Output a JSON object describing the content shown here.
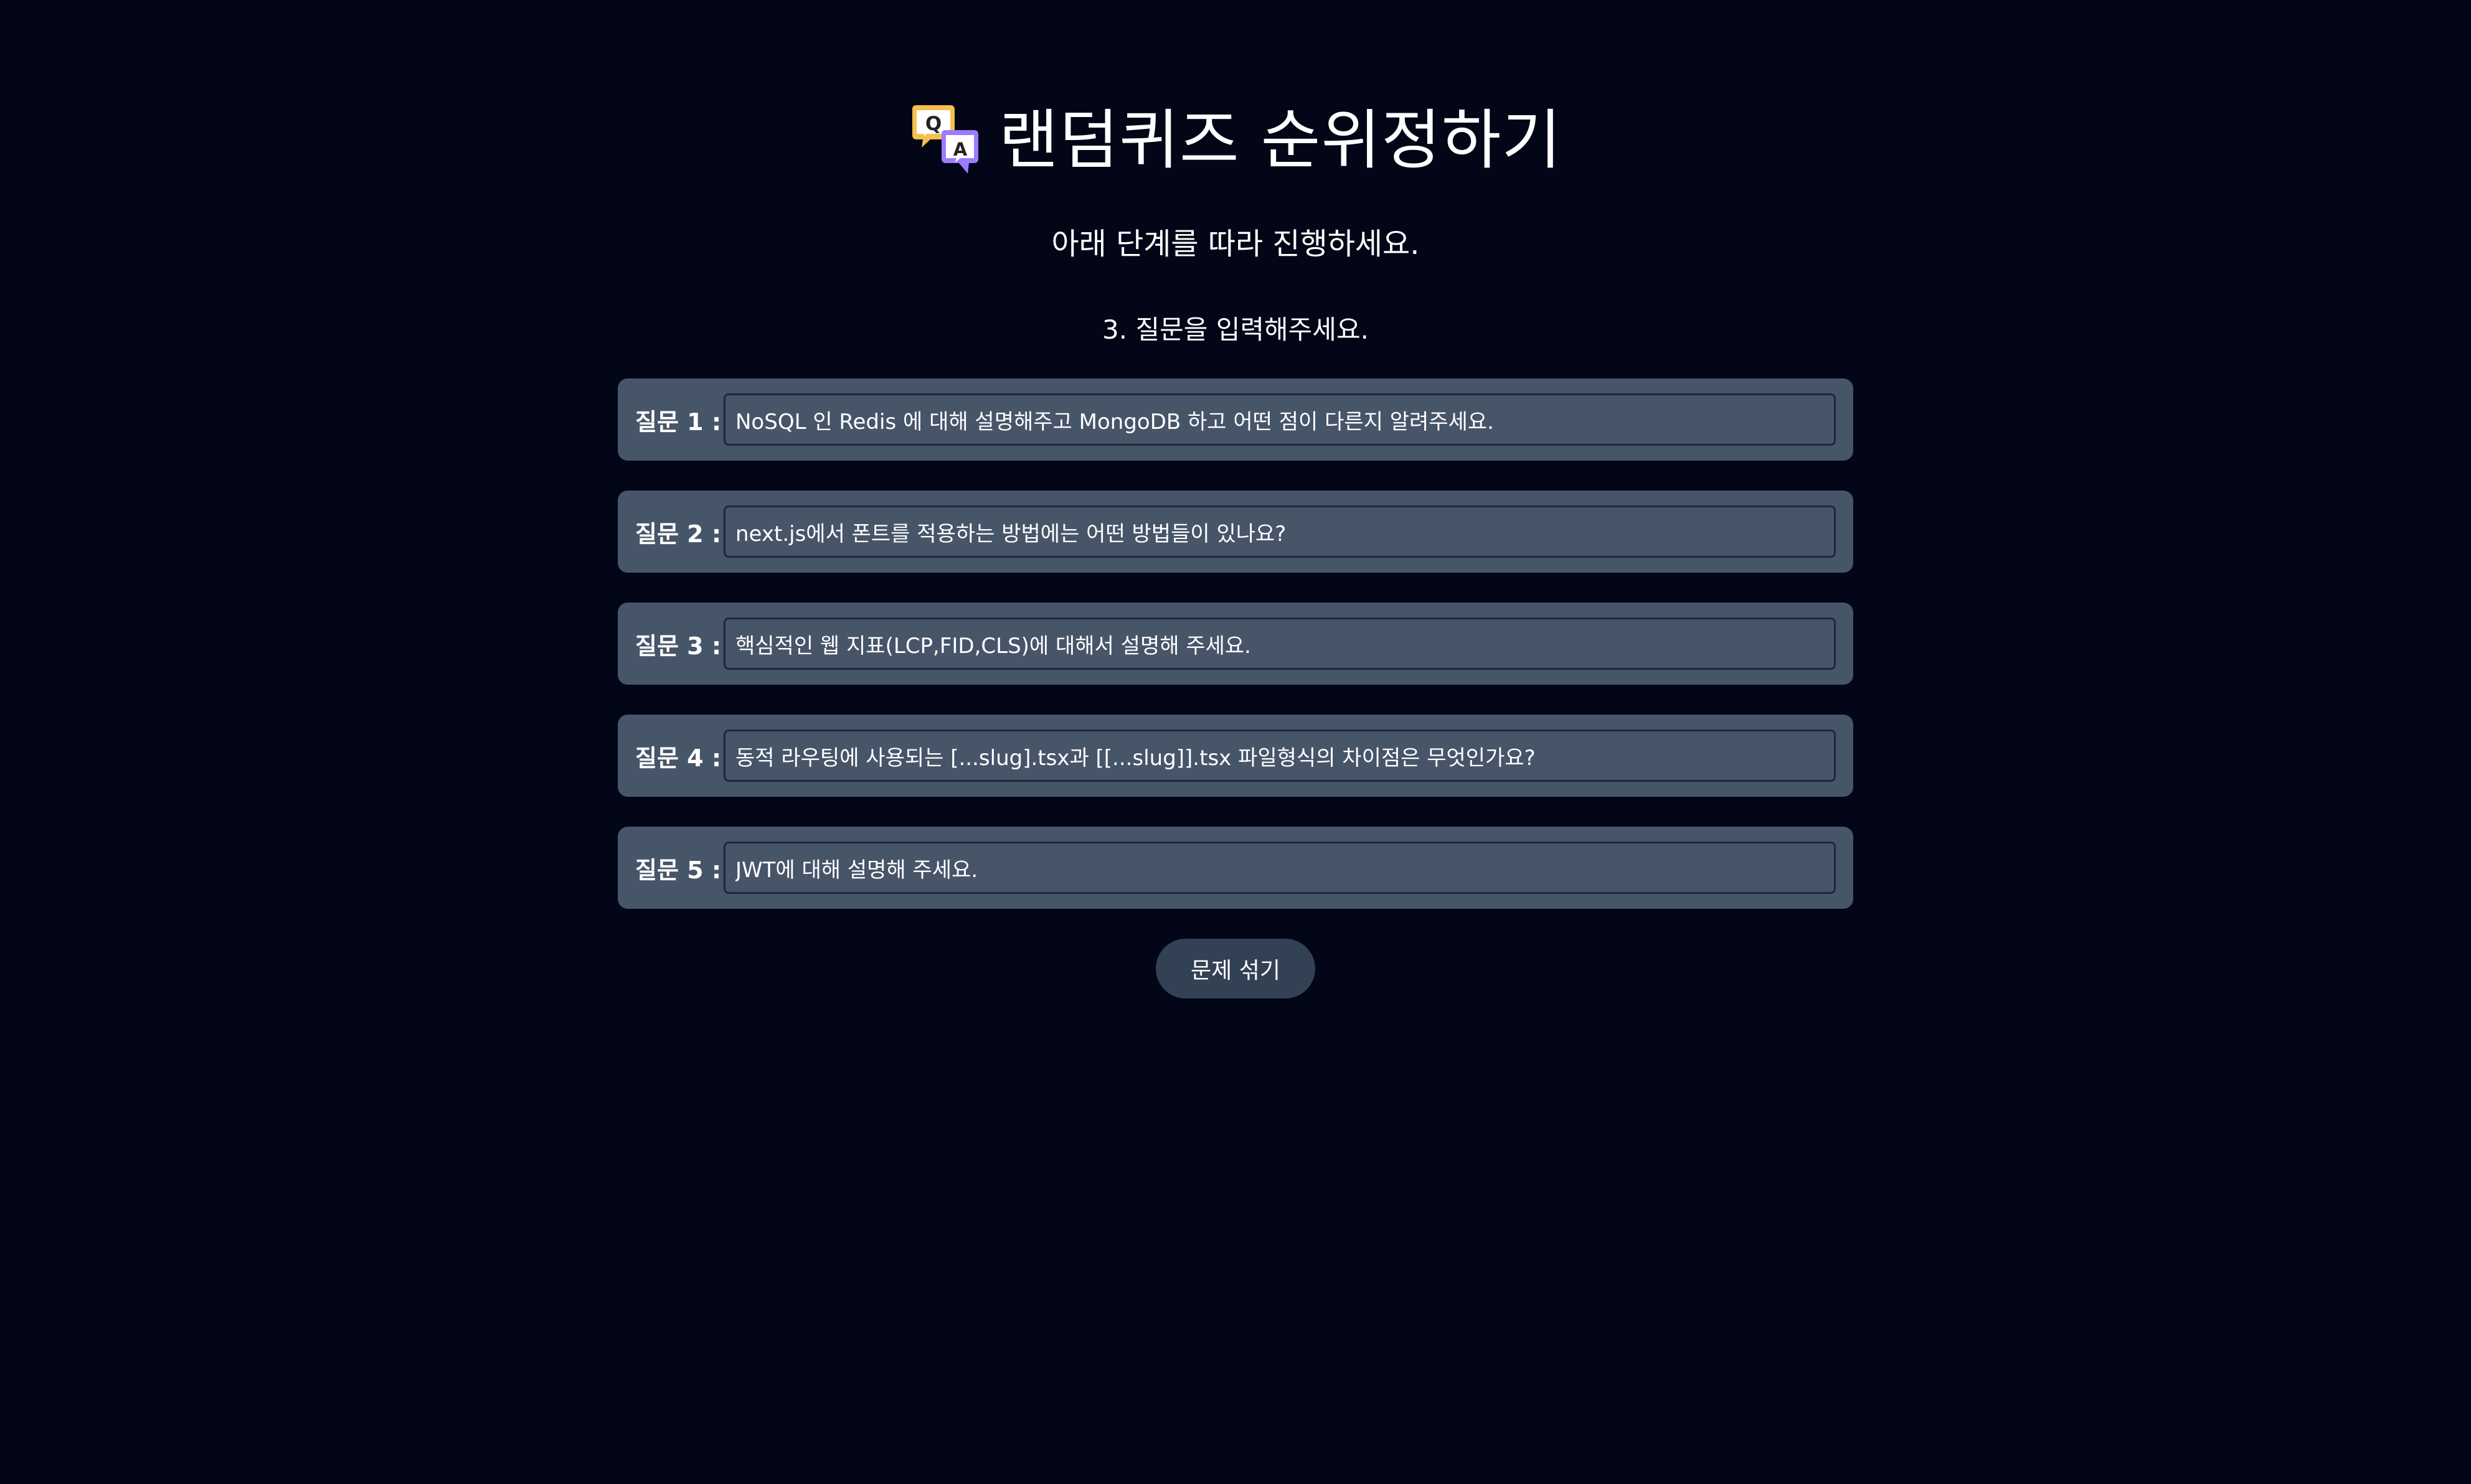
{
  "header": {
    "title": "랜덤퀴즈 순위정하기",
    "icon": "qa-speech-bubbles-icon",
    "subtitle": "아래 단계를 따라 진행하세요.",
    "step": "3. 질문을 입력해주세요."
  },
  "questions": [
    {
      "label": "질문 1 :",
      "value": "NoSQL 인 Redis 에 대해 설명해주고 MongoDB 하고 어떤 점이 다른지 알려주세요."
    },
    {
      "label": "질문 2 :",
      "value": "next.js에서 폰트를 적용하는 방법에는 어떤 방법들이 있나요?"
    },
    {
      "label": "질문 3 :",
      "value": "핵심적인 웹 지표(LCP,FID,CLS)에 대해서 설명해 주세요."
    },
    {
      "label": "질문 4 :",
      "value": "동적 라우팅에 사용되는 [...slug].tsx과 [[...slug]].tsx 파일형식의 차이점은 무엇인가요?"
    },
    {
      "label": "질문 5 :",
      "value": "JWT에 대해 설명해 주세요."
    }
  ],
  "actions": {
    "shuffle_label": "문제 섞기"
  },
  "colors": {
    "background": "#020617",
    "card": "#475569",
    "input_border": "#1e293b",
    "button": "#334155",
    "text": "#ffffff"
  }
}
